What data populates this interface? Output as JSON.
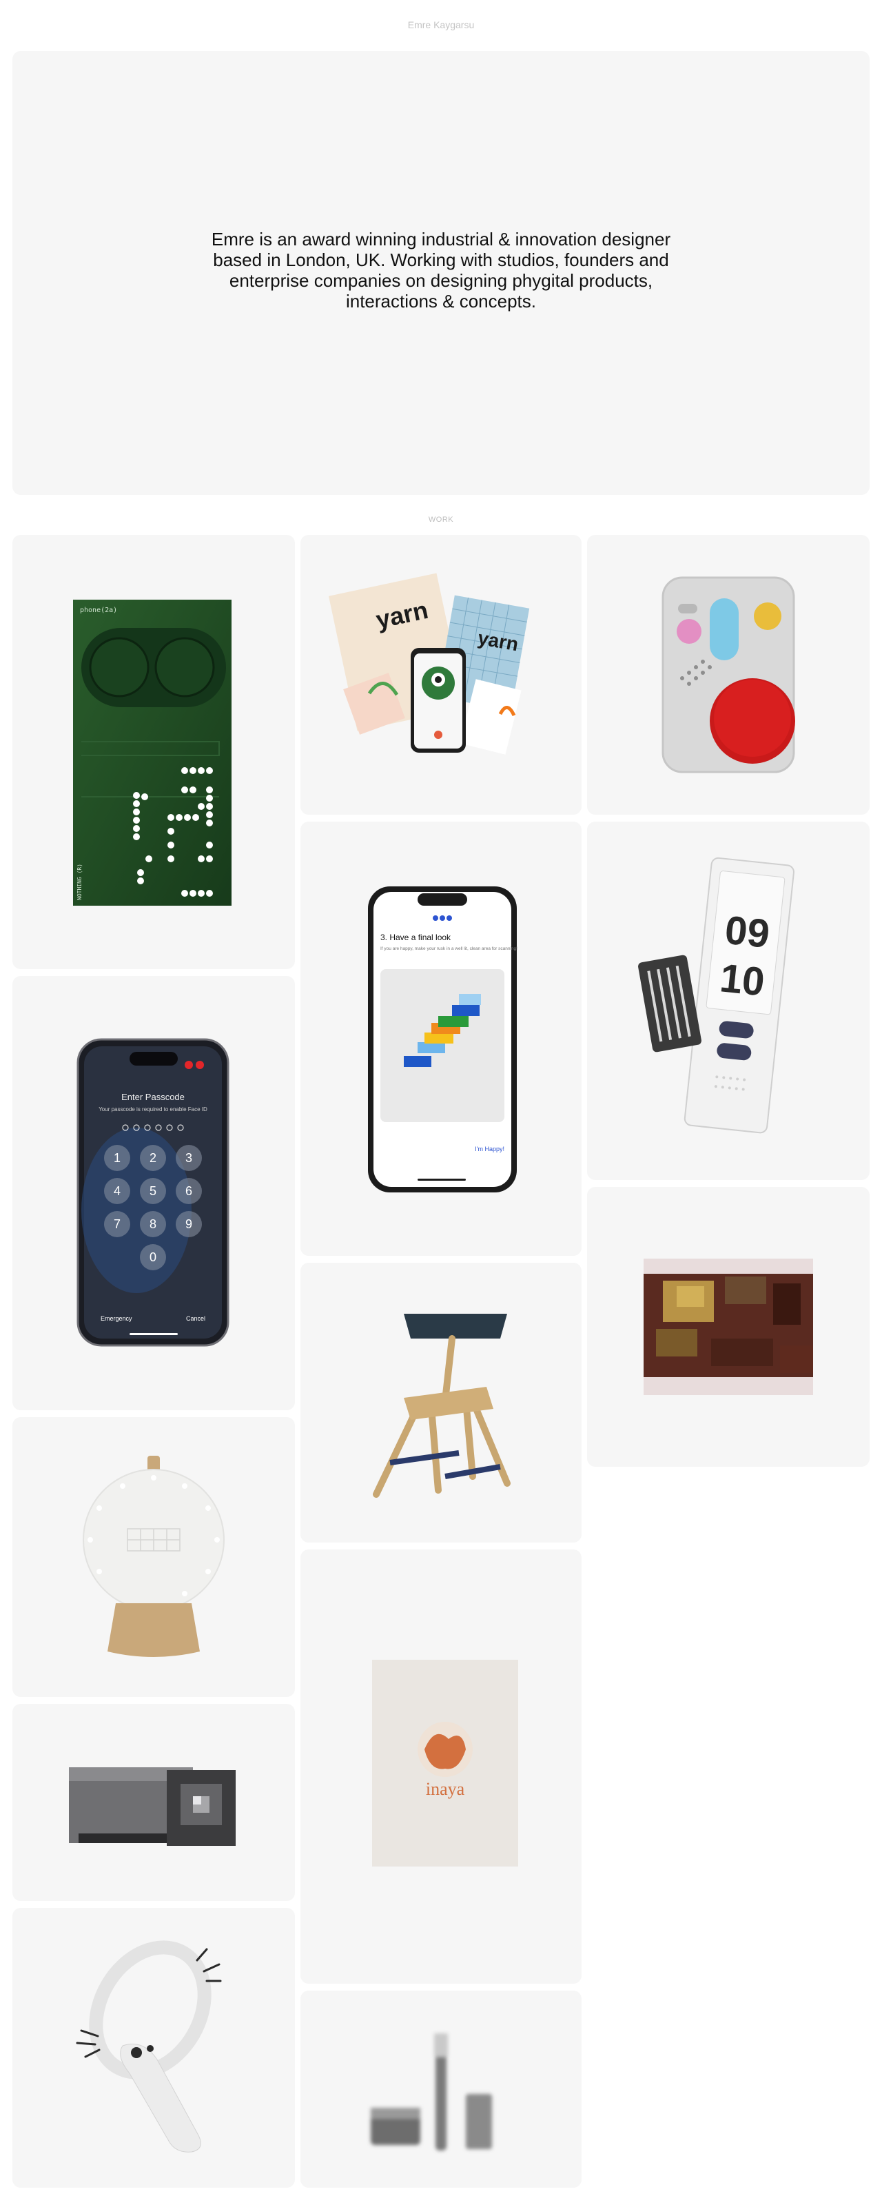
{
  "site": {
    "name": "Emre Kaygarsu"
  },
  "hero": {
    "text": "Emre is an award winning industrial & innovation designer based in London, UK. Working with studios, founders and enterprise companies on designing phygital products, interactions & concepts."
  },
  "work": {
    "label": "WORK",
    "projects": [
      {
        "name": "phone-2a",
        "screen_text": "phone(2a)",
        "vertical_text": "NOTHING (R)"
      },
      {
        "name": "yarn",
        "logo_text": "yarn"
      },
      {
        "name": "toy-controller"
      },
      {
        "name": "passcode-phone",
        "title": "Enter Passcode",
        "subtitle": "Your passcode is required to enable Face ID",
        "keys": [
          "1",
          "2",
          "3",
          "4",
          "5",
          "6",
          "7",
          "8",
          "9",
          "0"
        ],
        "emergency": "Emergency",
        "cancel": "Cancel"
      },
      {
        "name": "have-a-final-look",
        "title": "3. Have a final look",
        "subtitle": "If you are happy, make your rusk in a well lit, clean area for scanning!",
        "link": "I'm Happy!"
      },
      {
        "name": "flip-clock-device",
        "hour": "09",
        "minute": "10"
      },
      {
        "name": "pixelated-project-1"
      },
      {
        "name": "chair"
      },
      {
        "name": "lamp"
      },
      {
        "name": "pixelated-project-2"
      },
      {
        "name": "inaya",
        "brand": "inaya"
      },
      {
        "name": "vr-controller"
      },
      {
        "name": "blurred-products"
      }
    ]
  },
  "colors": {
    "card_bg": "#f6f6f6",
    "label": "#bdbdbd",
    "accent_green": "#1f4a22",
    "accent_red": "#d81f1f",
    "inaya_orange": "#d3703f"
  }
}
